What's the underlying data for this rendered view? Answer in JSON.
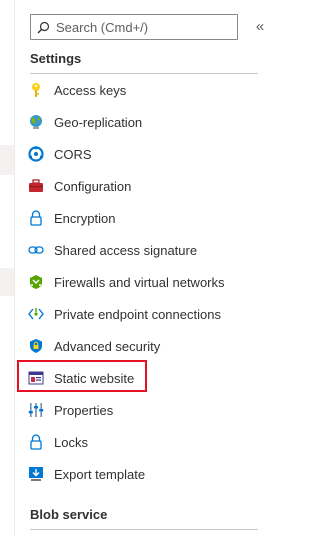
{
  "search": {
    "placeholder": "Search (Cmd+/)",
    "value": ""
  },
  "collapse_label": "«",
  "sections": {
    "settings": "Settings",
    "blob_service": "Blob service"
  },
  "settings_items": [
    {
      "label": "Access keys",
      "icon": "key-icon"
    },
    {
      "label": "Geo-replication",
      "icon": "globe-icon"
    },
    {
      "label": "CORS",
      "icon": "cors-icon"
    },
    {
      "label": "Configuration",
      "icon": "toolbox-icon"
    },
    {
      "label": "Encryption",
      "icon": "lock-icon"
    },
    {
      "label": "Shared access signature",
      "icon": "link-icon"
    },
    {
      "label": "Firewalls and virtual networks",
      "icon": "firewall-icon"
    },
    {
      "label": "Private endpoint connections",
      "icon": "private-endpoint-icon"
    },
    {
      "label": "Advanced security",
      "icon": "shield-icon"
    },
    {
      "label": "Static website",
      "icon": "static-website-icon",
      "highlighted": true
    },
    {
      "label": "Properties",
      "icon": "properties-icon"
    },
    {
      "label": "Locks",
      "icon": "locks-icon"
    },
    {
      "label": "Export template",
      "icon": "export-template-icon"
    }
  ],
  "colors": {
    "highlight_border": "#e81123",
    "text": "#323130",
    "icon_blue": "#0078d4"
  }
}
